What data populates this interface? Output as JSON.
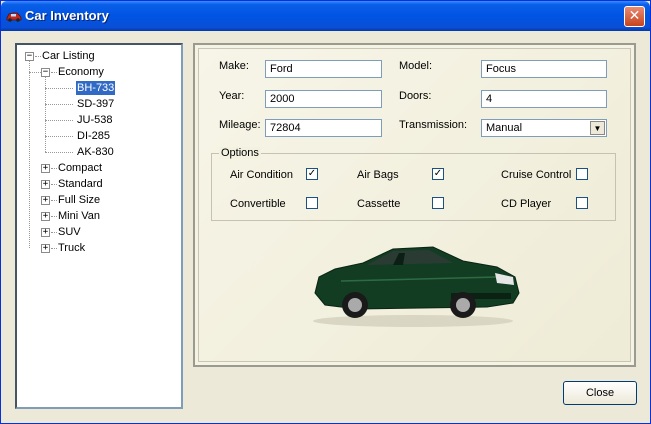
{
  "window": {
    "title": "Car Inventory"
  },
  "tree": {
    "root": "Car Listing",
    "categories": [
      "Economy",
      "Compact",
      "Standard",
      "Full Size",
      "Mini Van",
      "SUV",
      "Truck"
    ],
    "economy_items": [
      "BH-733",
      "SD-397",
      "JU-538",
      "DI-285",
      "AK-830"
    ],
    "selected": "BH-733"
  },
  "form": {
    "make_label": "Make:",
    "make_value": "Ford",
    "model_label": "Model:",
    "model_value": "Focus",
    "year_label": "Year:",
    "year_value": "2000",
    "doors_label": "Doors:",
    "doors_value": "4",
    "mileage_label": "Mileage:",
    "mileage_value": "72804",
    "transmission_label": "Transmission:",
    "transmission_value": "Manual"
  },
  "options": {
    "title": "Options",
    "items": [
      {
        "label": "Air Condition",
        "checked": true
      },
      {
        "label": "Air Bags",
        "checked": true
      },
      {
        "label": "Cruise Control",
        "checked": false
      },
      {
        "label": "Convertible",
        "checked": false
      },
      {
        "label": "Cassette",
        "checked": false
      },
      {
        "label": "CD Player",
        "checked": false
      }
    ]
  },
  "buttons": {
    "close": "Close"
  },
  "colors": {
    "titlebar": "#0054e3",
    "selection": "#316ac5",
    "car_body": "#123d22"
  }
}
